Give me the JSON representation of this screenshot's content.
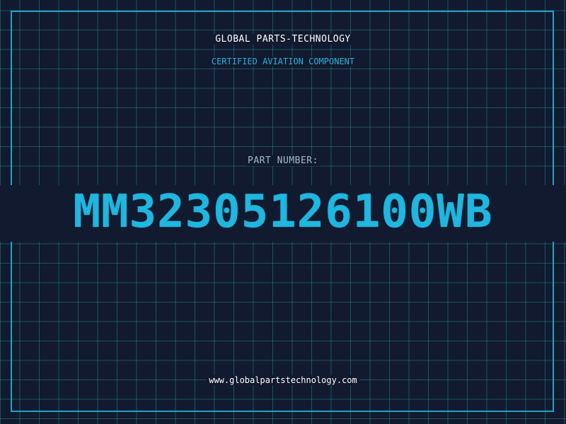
{
  "header": {
    "company": "GLOBAL PARTS-TECHNOLOGY",
    "tagline": "CERTIFIED AVIATION COMPONENT"
  },
  "part": {
    "label": "PART NUMBER:",
    "number": "MM32305126100WB"
  },
  "footer": {
    "url": "www.globalpartstechnology.com"
  },
  "colors": {
    "background": "#111a2e",
    "grid": "#228296",
    "accent": "#1fb6df",
    "text": "#ffffff"
  }
}
